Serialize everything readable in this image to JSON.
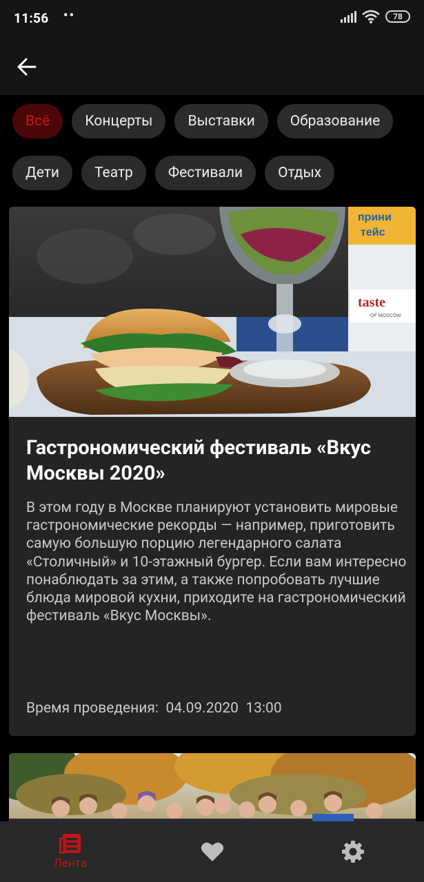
{
  "status_bar": {
    "time": "11:56",
    "dots": "••",
    "battery": "78"
  },
  "filters": {
    "row1": [
      "Всё",
      "Концерты",
      "Выставки",
      "Образование"
    ],
    "row2": [
      "Дети",
      "Театр",
      "Фестивали",
      "Отдых"
    ],
    "active": "Всё"
  },
  "event": {
    "title": "Гастрономический фестиваль «Вкус Москвы 2020»",
    "description": "В этом году в Москве планируют установить мировые гастрономические рекорды — например, приготовить самую большую порцию легендарного салата «Столичный» и 10-этажный бургер. Если вам интересно понаблюдать за этим, а также попробовать лучшие блюда мировой кухни, приходите на гастрономический фестиваль «Вкус Москвы».",
    "time_label": "Время проведения:",
    "date": "04.09.2020",
    "hour": "13:00",
    "image_sign_text": "taste",
    "image_sign_sub": "OF MOSCOW",
    "image_banner_text": "прини тейс"
  },
  "bottom_nav": {
    "feed_label": "Лента"
  },
  "colors": {
    "accent": "#d0141a",
    "chip_active_bg": "#4a0608",
    "chip_bg": "#2b2b2b",
    "card_bg": "#242424",
    "bar_bg": "#151515",
    "nav_bg": "#282828"
  },
  "icons": [
    "back-arrow-icon",
    "signal-icon",
    "wifi-icon",
    "battery-icon",
    "feed-icon",
    "heart-icon",
    "gear-icon"
  ]
}
